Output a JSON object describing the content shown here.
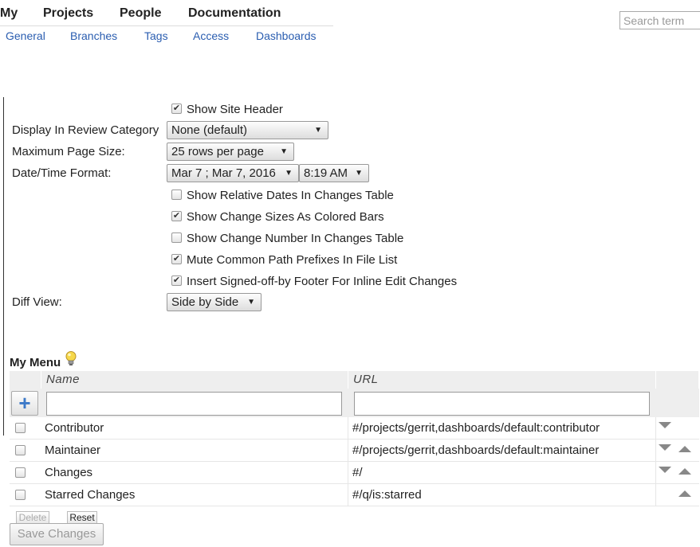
{
  "top_nav": {
    "my": "My",
    "projects": "Projects",
    "people": "People",
    "documentation": "Documentation"
  },
  "sub_nav": {
    "general": "General",
    "branches": "Branches",
    "tags": "Tags",
    "access": "Access",
    "dashboards": "Dashboards"
  },
  "search": {
    "placeholder": "Search term"
  },
  "prefs": {
    "show_site_header": {
      "label": "Show Site Header",
      "checked": true
    },
    "review_category": {
      "label": "Display In Review Category",
      "value": "None (default)"
    },
    "page_size": {
      "label": "Maximum Page Size:",
      "value": "25 rows per page"
    },
    "datetime": {
      "label": "Date/Time Format:",
      "date_value": "Mar 7 ; Mar 7, 2016",
      "time_value": "8:19 AM"
    },
    "relative_dates": {
      "label": "Show Relative Dates In Changes Table",
      "checked": false
    },
    "change_sizes": {
      "label": "Show Change Sizes As Colored Bars",
      "checked": true
    },
    "change_number": {
      "label": "Show Change Number In Changes Table",
      "checked": false
    },
    "mute_prefixes": {
      "label": "Mute Common Path Prefixes In File List",
      "checked": true
    },
    "signed_off": {
      "label": "Insert Signed-off-by Footer For Inline Edit Changes",
      "checked": true
    },
    "diff_view": {
      "label": "Diff View:",
      "value": "Side by Side"
    }
  },
  "my_menu": {
    "title": "My Menu",
    "columns": {
      "name": "Name",
      "url": "URL"
    },
    "add_symbol": "+",
    "rows": [
      {
        "name": "Contributor",
        "url": "#/projects/gerrit,dashboards/default:contributor",
        "move_down": true,
        "move_up": false
      },
      {
        "name": "Maintainer",
        "url": "#/projects/gerrit,dashboards/default:maintainer",
        "move_down": true,
        "move_up": true
      },
      {
        "name": "Changes",
        "url": "#/",
        "move_down": true,
        "move_up": true
      },
      {
        "name": "Starred Changes",
        "url": "#/q/is:starred",
        "move_down": false,
        "move_up": true
      }
    ],
    "delete_label": "Delete",
    "reset_label": "Reset"
  },
  "save_label": "Save Changes",
  "check_glyph": "✔",
  "arrow_glyph": "▼"
}
